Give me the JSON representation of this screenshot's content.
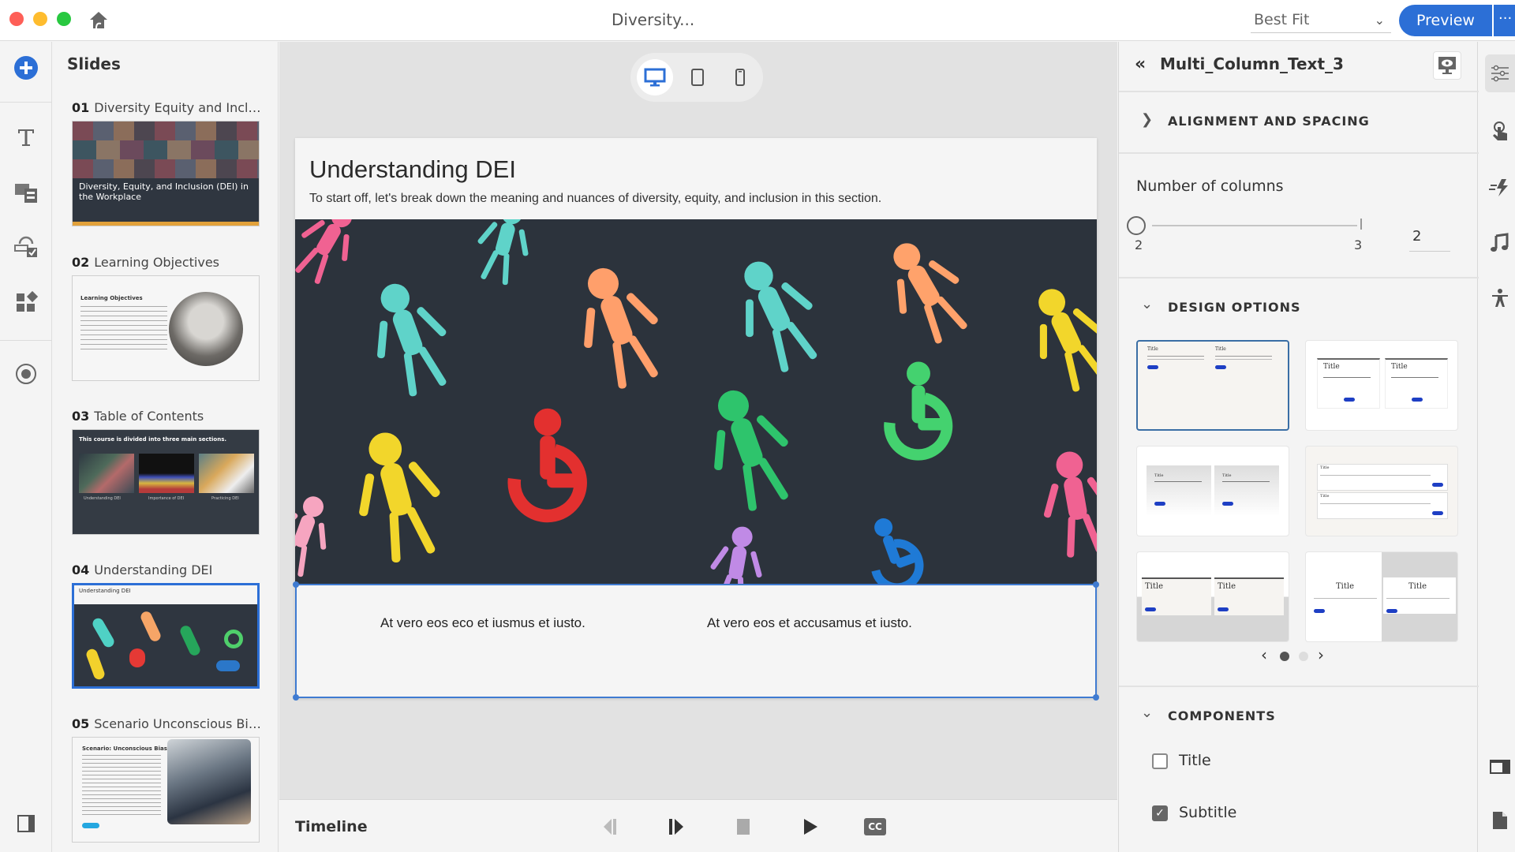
{
  "window": {
    "title": "Diversity...",
    "traffic_colors": {
      "close": "#fe5f57",
      "minimize": "#febc2e",
      "maximize": "#28c840"
    }
  },
  "toolbar": {
    "zoom_value": "Best Fit",
    "preview_label": "Preview",
    "more_label": "···",
    "accent": "#2c6fd6"
  },
  "left_rail": {
    "items": [
      {
        "icon": "add-circle-icon",
        "label": "Add"
      },
      {
        "icon": "text-icon",
        "label": "Text"
      },
      {
        "icon": "media-icon",
        "label": "Media"
      },
      {
        "icon": "interaction-icon",
        "label": "Interactions"
      },
      {
        "icon": "widgets-icon",
        "label": "Widgets"
      },
      {
        "icon": "record-icon",
        "label": "Record"
      },
      {
        "icon": "panel-toggle-icon",
        "label": "Toggle panel"
      }
    ]
  },
  "slides_panel": {
    "title": "Slides",
    "items": [
      {
        "number": "01",
        "title": "Diversity Equity and Inclusi...",
        "thumb_caption": "Diversity, Equity, and Inclusion (DEI) in the Workplace"
      },
      {
        "number": "02",
        "title": "Learning Objectives",
        "thumb_caption": "Learning Objectives"
      },
      {
        "number": "03",
        "title": "Table of Contents",
        "thumb_caption": "This course is divided into three main sections.",
        "thumb_sections": [
          "Understanding DEI",
          "Importance of DEI",
          "Practicing DEI"
        ]
      },
      {
        "number": "04",
        "title": "Understanding DEI",
        "thumb_caption": "Understanding DEI",
        "active": true
      },
      {
        "number": "05",
        "title": "Scenario Unconscious Bias",
        "thumb_caption": "Scenario: Unconscious Bias"
      }
    ]
  },
  "canvas": {
    "device_modes": [
      {
        "icon": "desktop-icon",
        "active": true
      },
      {
        "icon": "tablet-icon",
        "active": false
      },
      {
        "icon": "mobile-icon",
        "active": false
      }
    ],
    "slide": {
      "title": "Understanding DEI",
      "subtitle": "To start off, let's break down the meaning and nuances of diversity, equity, and inclusion in this section.",
      "columns": [
        "At vero eos eco et iusmus et iusto.",
        "At vero eos et accusamus et iusto."
      ]
    }
  },
  "timeline": {
    "label": "Timeline",
    "controls": [
      "step-back-icon",
      "step-forward-icon",
      "stop-icon",
      "play-icon",
      "closed-captions-icon"
    ],
    "cc_label": "CC"
  },
  "properties": {
    "component_name": "Multi_Column_Text_3",
    "sections": {
      "alignment": "ALIGNMENT AND SPACING",
      "design": "DESIGN OPTIONS",
      "components": "COMPONENTS"
    },
    "columns": {
      "label": "Number of columns",
      "min": "2",
      "max": "3",
      "value": "2",
      "fraction": 0
    },
    "design_options": {
      "selected_index": 0,
      "page": 1,
      "page_count": 2,
      "option_title": "Title"
    },
    "components": [
      {
        "label": "Title",
        "checked": false
      },
      {
        "label": "Subtitle",
        "checked": true
      }
    ]
  },
  "right_rail": {
    "items": [
      "properties-sliders-icon",
      "interaction-touch-icon",
      "animation-icon",
      "audio-icon",
      "accessibility-icon",
      "layout-icon",
      "notes-icon"
    ]
  }
}
